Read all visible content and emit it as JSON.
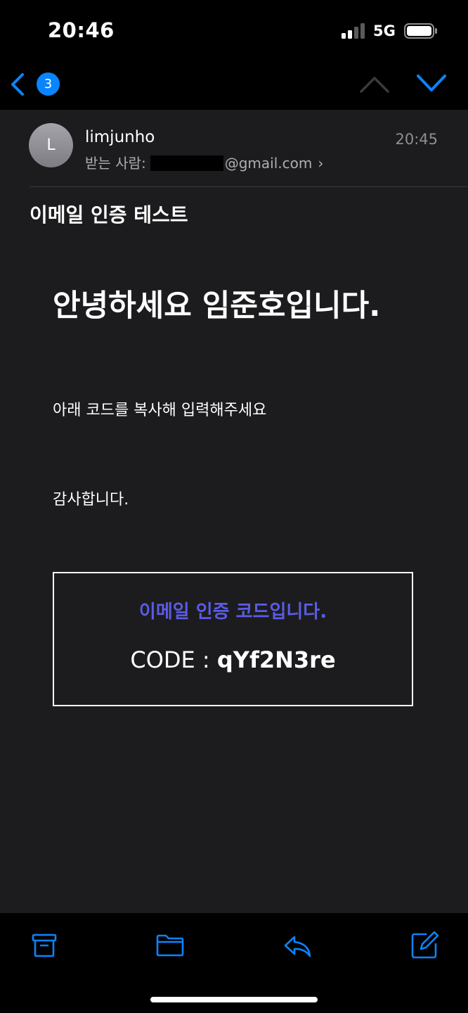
{
  "status_bar": {
    "time": "20:46",
    "network": "5G",
    "signal": "signal-icon",
    "battery": "battery-icon"
  },
  "nav": {
    "unread_count": "3",
    "back_icon": "chevron-left-icon",
    "prev_icon": "chevron-up-icon",
    "next_icon": "chevron-down-icon"
  },
  "header": {
    "avatar_initial": "L",
    "sender": "limjunho",
    "recipient_label": "받는 사람:",
    "recipient_domain": "@gmail.com",
    "recipient_chevron": "›",
    "received_time": "20:45"
  },
  "subject": "이메일 인증 테스트",
  "body": {
    "greeting": "안녕하세요 임준호입니다.",
    "line1": "아래 코드를 복사해 입력해주세요",
    "line2": "감사합니다.",
    "code_title": "이메일 인증 코드입니다.",
    "code_label": "CODE : ",
    "code_value": "qYf2N3re"
  },
  "colors": {
    "accent": "#0a84ff",
    "code_title": "#5b5be6",
    "background": "#1c1c1e"
  },
  "toolbar": {
    "icons": [
      "archive-icon",
      "folder-icon",
      "reply-icon",
      "compose-icon"
    ]
  }
}
